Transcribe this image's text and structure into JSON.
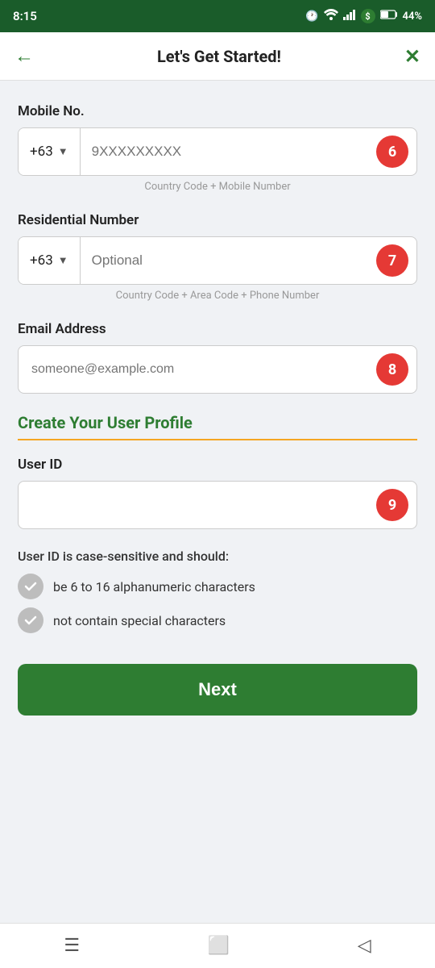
{
  "statusBar": {
    "time": "8:15",
    "battery": "44%"
  },
  "nav": {
    "title": "Let's Get Started!",
    "backLabel": "←",
    "closeLabel": "✕"
  },
  "mobileSection": {
    "label": "Mobile No.",
    "countryCode": "+63",
    "placeholder": "9XXXXXXXXX",
    "badgeNumber": "6",
    "hint": "Country Code + Mobile Number"
  },
  "residentialSection": {
    "label": "Residential Number",
    "countryCode": "+63",
    "placeholder": "Optional",
    "badgeNumber": "7",
    "hint": "Country Code + Area Code + Phone Number"
  },
  "emailSection": {
    "label": "Email Address",
    "placeholder": "someone@example.com",
    "badgeNumber": "8"
  },
  "profileSection": {
    "heading": "Create Your User Profile"
  },
  "userIdSection": {
    "label": "User ID",
    "badgeNumber": "9",
    "validationNote": "User ID is case-sensitive and should:",
    "rules": [
      {
        "text": "be 6 to 16 alphanumeric characters"
      },
      {
        "text": "not contain special characters"
      }
    ]
  },
  "nextButton": {
    "label": "Next"
  }
}
